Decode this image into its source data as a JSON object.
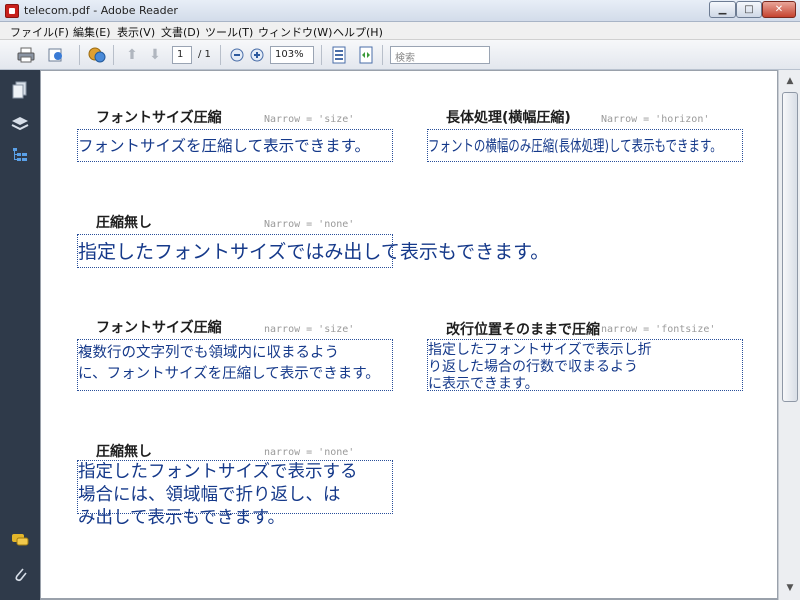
{
  "window": {
    "title": "telecom.pdf - Adobe Reader",
    "min_label": "▁",
    "max_label": "□",
    "close_label": "✕"
  },
  "menu": [
    "ファイル(F)",
    "編集(E)",
    "表示(V)",
    "文書(D)",
    "ツール(T)",
    "ウィンドウ(W)",
    "ヘルプ(H)"
  ],
  "toolbar": {
    "page_current": "1",
    "page_total": "/ 1",
    "zoom": "103%",
    "search_placeholder": "検索",
    "icons": [
      "print-icon",
      "share-icon",
      "collaborate-icon",
      "page-up-icon",
      "page-down-icon",
      "zoom-out-icon",
      "zoom-in-icon",
      "fit-page-icon",
      "fit-width-icon"
    ]
  },
  "nav": {
    "icons": [
      "pages-icon",
      "layers-icon",
      "bookmarks-icon",
      "comments-icon",
      "attachments-icon"
    ]
  },
  "fields": [
    {
      "label": "フォントサイズ圧縮",
      "code": "Narrow = 'size'",
      "lines": [
        "フォントサイズを圧縮して表示できます。"
      ]
    },
    {
      "label": "長体処理(横幅圧縮)",
      "code": "Narrow = 'horizon'",
      "lines": [
        "フォントの横幅のみ圧縮(長体処理)して表示もできます。"
      ]
    },
    {
      "label": "圧縮無し",
      "code": "Narrow = 'none'",
      "lines": [
        "指定したフォントサイズではみ出して表示もできます。"
      ]
    },
    {
      "label": "フォントサイズ圧縮",
      "code": "narrow = 'size'",
      "lines": [
        "複数行の文字列でも領域内に収まるよう",
        "に、フォントサイズを圧縮して表示できます。"
      ]
    },
    {
      "label": "改行位置そのままで圧縮",
      "code": "narrow = 'fontsize'",
      "lines": [
        "指定したフォントサイズで表示し折",
        "り返した場合の行数で収まるよう",
        "に表示できます。"
      ]
    },
    {
      "label": "圧縮無し",
      "code": "narrow = 'none'",
      "lines": [
        "指定したフォントサイズで表示する",
        "場合には、領域幅で折り返し、は",
        "み出して表示もできます。"
      ]
    }
  ]
}
